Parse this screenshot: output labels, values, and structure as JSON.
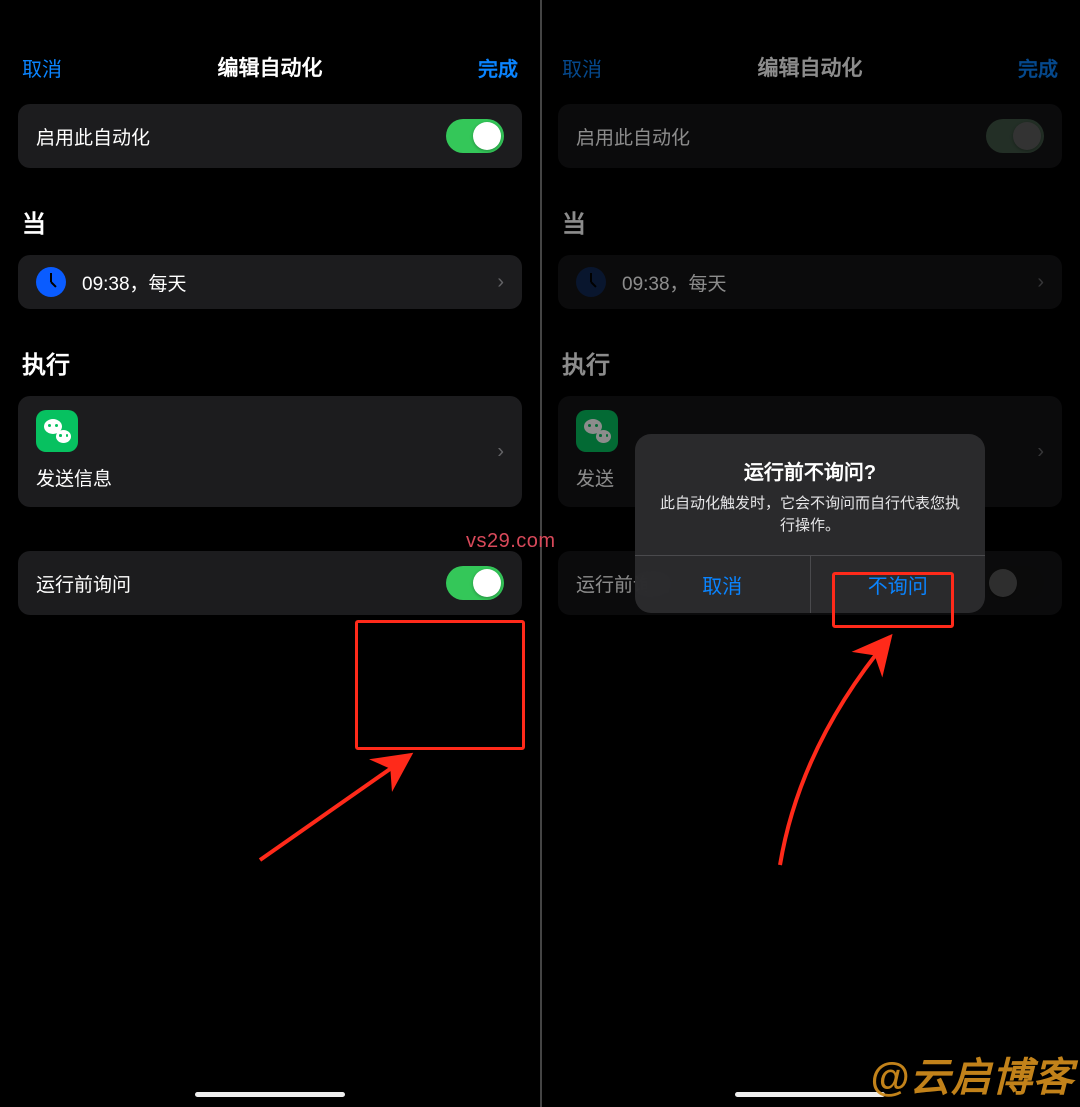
{
  "left": {
    "header": {
      "cancel": "取消",
      "title": "编辑自动化",
      "done": "完成"
    },
    "enable_label": "启用此自动化",
    "when_label": "当",
    "when_text": "09:38，每天",
    "exec_label": "执行",
    "exec_action": "发送信息",
    "ask_label": "运行前询问"
  },
  "right": {
    "header": {
      "cancel": "取消",
      "title": "编辑自动化",
      "done": "完成"
    },
    "enable_label": "启用此自动化",
    "when_label": "当",
    "when_text": "09:38，每天",
    "exec_label": "执行",
    "exec_action_short": "发送",
    "ask_label": "运行前询问",
    "alert": {
      "title": "运行前不询问?",
      "message": "此自动化触发时，它会不询问而自行代表您执行操作。",
      "cancel": "取消",
      "confirm": "不询问"
    }
  },
  "watermark_center": "vs29.com",
  "watermark_corner": "@云启博客"
}
